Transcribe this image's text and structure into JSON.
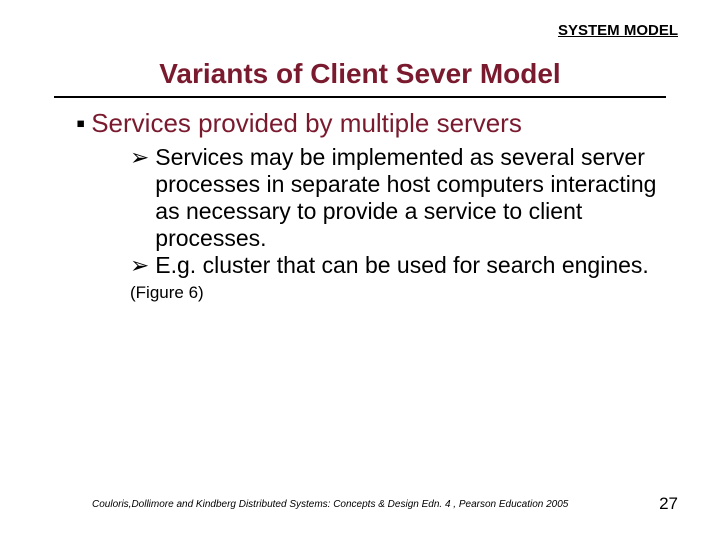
{
  "header": {
    "label": "SYSTEM MODEL"
  },
  "title": "Variants of Client Sever Model",
  "bullets": {
    "lvl1": {
      "text": "Services provided by multiple servers"
    },
    "lvl2": [
      {
        "text": "Services may be implemented as several server processes in separate host computers interacting as necessary to provide a service to client processes."
      },
      {
        "text": "E.g. cluster that can be used for search engines."
      }
    ]
  },
  "figure_note": "(Figure 6)",
  "footer": {
    "citation": "Couloris,Dollimore and Kindberg  Distributed Systems: Concepts & Design  Edn. 4 , Pearson Education 2005",
    "page": "27"
  },
  "glyphs": {
    "square": "▪",
    "arrow": "➢"
  }
}
